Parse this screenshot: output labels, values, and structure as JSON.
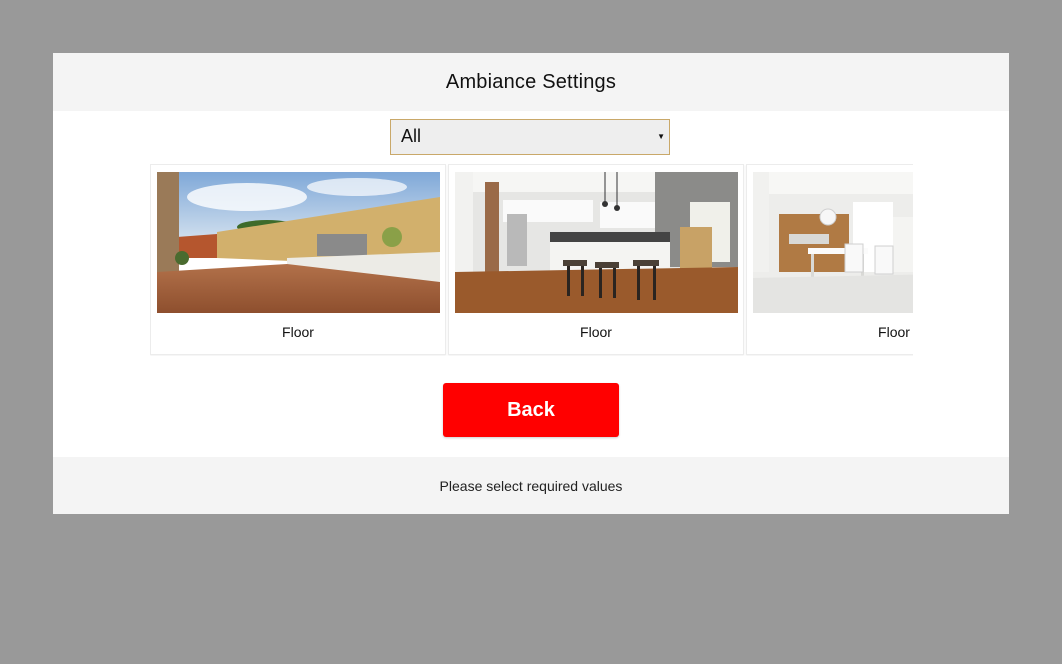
{
  "dialog": {
    "title": "Ambiance Settings",
    "filter": {
      "selected": "All"
    },
    "cards": [
      {
        "label": "Floor",
        "scene": "outdoor-deck"
      },
      {
        "label": "Floor",
        "scene": "kitchen"
      },
      {
        "label": "Floor",
        "scene": "dining-room"
      }
    ],
    "back_label": "Back",
    "footer_message": "Please select required values"
  },
  "colors": {
    "overlay": "#999999",
    "header_bg": "#f4f4f4",
    "back_button": "#ff0000",
    "select_border": "#c9a869"
  }
}
